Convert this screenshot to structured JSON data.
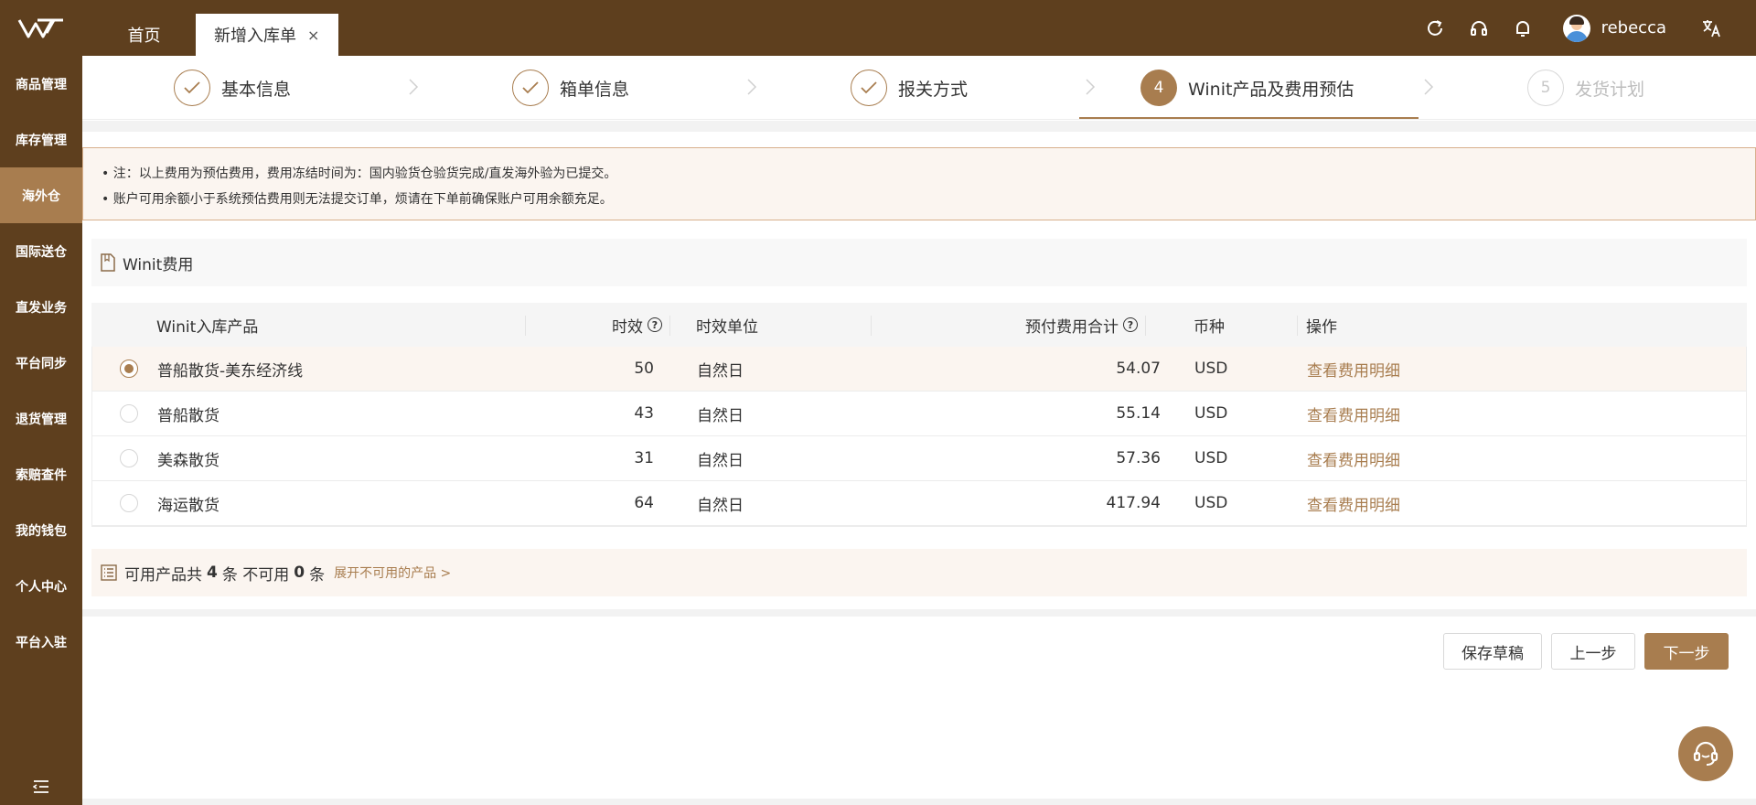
{
  "header": {
    "tabs": [
      {
        "label": "首页"
      },
      {
        "label": "新增入库单",
        "close": "×"
      }
    ],
    "username": "rebecca"
  },
  "sidebar": {
    "items": [
      {
        "label": "商品管理"
      },
      {
        "label": "库存管理"
      },
      {
        "label": "海外仓",
        "active": true
      },
      {
        "label": "国际送仓"
      },
      {
        "label": "直发业务"
      },
      {
        "label": "平台同步"
      },
      {
        "label": "退货管理"
      },
      {
        "label": "索赔查件"
      },
      {
        "label": "我的钱包"
      },
      {
        "label": "个人中心"
      },
      {
        "label": "平台入驻"
      }
    ]
  },
  "steps": [
    {
      "label": "基本信息",
      "status": "done"
    },
    {
      "label": "箱单信息",
      "status": "done"
    },
    {
      "label": "报关方式",
      "status": "done"
    },
    {
      "number": "4",
      "label": "Winit产品及费用预估",
      "status": "active"
    },
    {
      "number": "5",
      "label": "发货计划",
      "status": "pending"
    }
  ],
  "notice": {
    "lines": [
      "• 注：以上费用为预估费用，费用冻结时间为：国内验货仓验货完成/直发海外验为已提交。",
      "• 账户可用余额小于系统预估费用则无法提交订单，烦请在下单前确保账户可用余额充足。"
    ]
  },
  "section": {
    "title": "Winit费用"
  },
  "table": {
    "columns": {
      "product": "Winit入库产品",
      "duration": "时效",
      "unit": "时效单位",
      "total": "预付费用合计",
      "currency": "币种",
      "action": "操作"
    },
    "help_glyph": "?",
    "rows": [
      {
        "product": "普船散货-美东经济线",
        "duration": "50",
        "unit": "自然日",
        "total": "54.07",
        "currency": "USD",
        "action": "查看费用明细",
        "selected": true
      },
      {
        "product": "普船散货",
        "duration": "43",
        "unit": "自然日",
        "total": "55.14",
        "currency": "USD",
        "action": "查看费用明细",
        "selected": false
      },
      {
        "product": "美森散货",
        "duration": "31",
        "unit": "自然日",
        "total": "57.36",
        "currency": "USD",
        "action": "查看费用明细",
        "selected": false
      },
      {
        "product": "海运散货",
        "duration": "64",
        "unit": "自然日",
        "total": "417.94",
        "currency": "USD",
        "action": "查看费用明细",
        "selected": false
      }
    ]
  },
  "summary": {
    "prefix": "可用产品共",
    "available": "4",
    "mid": "条 不可用",
    "unavailable": "0",
    "suffix": "条",
    "expand": "展开不可用的产品 >"
  },
  "buttons": {
    "save_draft": "保存草稿",
    "prev": "上一步",
    "next": "下一步"
  },
  "colors": {
    "brand_dark": "#5e3f1e",
    "accent": "#a87d4f",
    "notice_bg": "#fbf5f0"
  }
}
